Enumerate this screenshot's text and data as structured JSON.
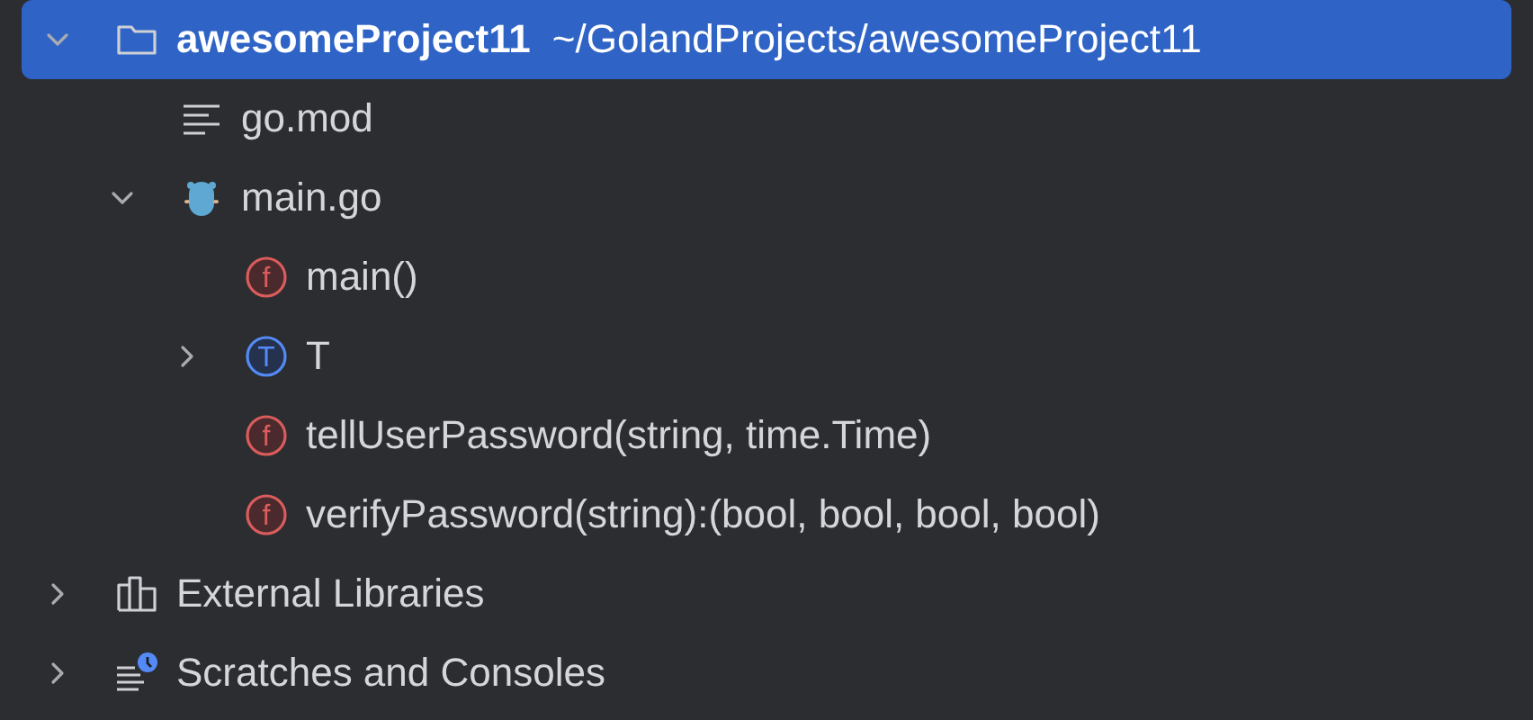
{
  "tree": [
    {
      "kind": "folder",
      "label": "awesomeProject11",
      "detail": "~/GolandProjects/awesomeProject11",
      "selected": true,
      "expanded": true,
      "children": [
        {
          "kind": "file",
          "label": "go.mod",
          "selected": false
        },
        {
          "kind": "gofile",
          "label": "main.go",
          "selected": false,
          "expanded": true,
          "children": [
            {
              "kind": "func",
              "badge": "f",
              "label": "main()",
              "selected": false
            },
            {
              "kind": "type",
              "badge": "T",
              "label": "T",
              "selected": false,
              "expanded": false
            },
            {
              "kind": "func",
              "badge": "f",
              "label": "tellUserPassword(string, time.Time)",
              "selected": false
            },
            {
              "kind": "func",
              "badge": "f",
              "label": "verifyPassword(string):(bool, bool, bool, bool)",
              "selected": false
            }
          ]
        }
      ]
    },
    {
      "kind": "library",
      "label": "External Libraries",
      "selected": false,
      "expanded": false
    },
    {
      "kind": "scratches",
      "label": "Scratches and Consoles",
      "selected": false,
      "expanded": false
    }
  ]
}
